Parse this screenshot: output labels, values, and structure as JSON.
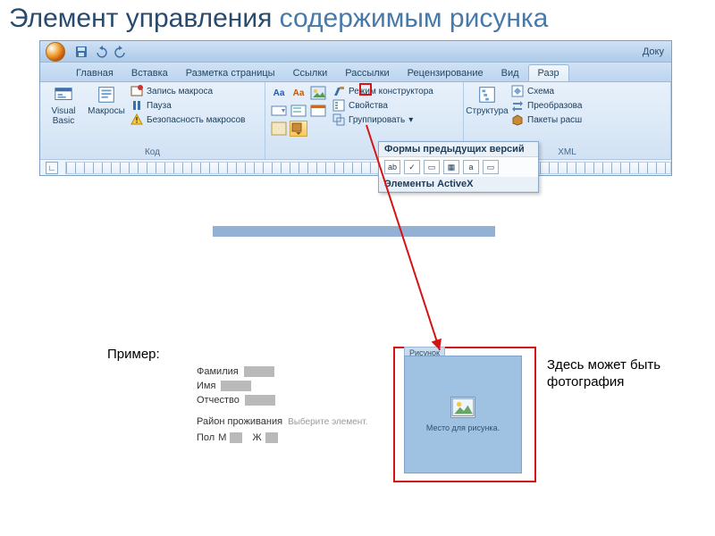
{
  "title_prefix": "Элемент управления ",
  "title_accent": "содержимым рисунка",
  "qat": {
    "doc_title": "Доку"
  },
  "tabs": [
    "Главная",
    "Вставка",
    "Разметка страницы",
    "Ссылки",
    "Рассылки",
    "Рецензирование",
    "Вид",
    "Разр"
  ],
  "active_tab_index": 7,
  "groups": {
    "code": {
      "label": "Код",
      "visual_basic": "Visual\nBasic",
      "macros": "Макросы",
      "record_macro": "Запись макроса",
      "pause": "Пауза",
      "macro_security": "Безопасность макросов"
    },
    "controls": {
      "aa_rich": "Aa",
      "aa_plain": "Aa",
      "design_mode": "Режим конструктора",
      "properties": "Свойства",
      "group": "Группировать"
    },
    "structure": {
      "structure": "Структура",
      "schema": "Схема",
      "transforms": "Преобразова",
      "packages": "Пакеты расш",
      "label": "XML"
    }
  },
  "dropdown": {
    "sect1": "Формы предыдущих версий",
    "sect1_items": [
      "ab",
      "✓",
      "▭",
      "▦",
      "a",
      "▭"
    ],
    "sect2": "Элементы ActiveX"
  },
  "example_label": "Пример:",
  "form": {
    "lastname": "Фамилия",
    "firstname": "Имя",
    "patronymic": "Отчество",
    "region": "Район проживания",
    "region_hint": "Выберите элемент.",
    "gender_label": "Пол",
    "gender_m": "М",
    "gender_f": "Ж"
  },
  "picture": {
    "tab": "Рисунок",
    "placeholder": "Место для рисунка."
  },
  "side_note": "Здесь может быть фотография"
}
